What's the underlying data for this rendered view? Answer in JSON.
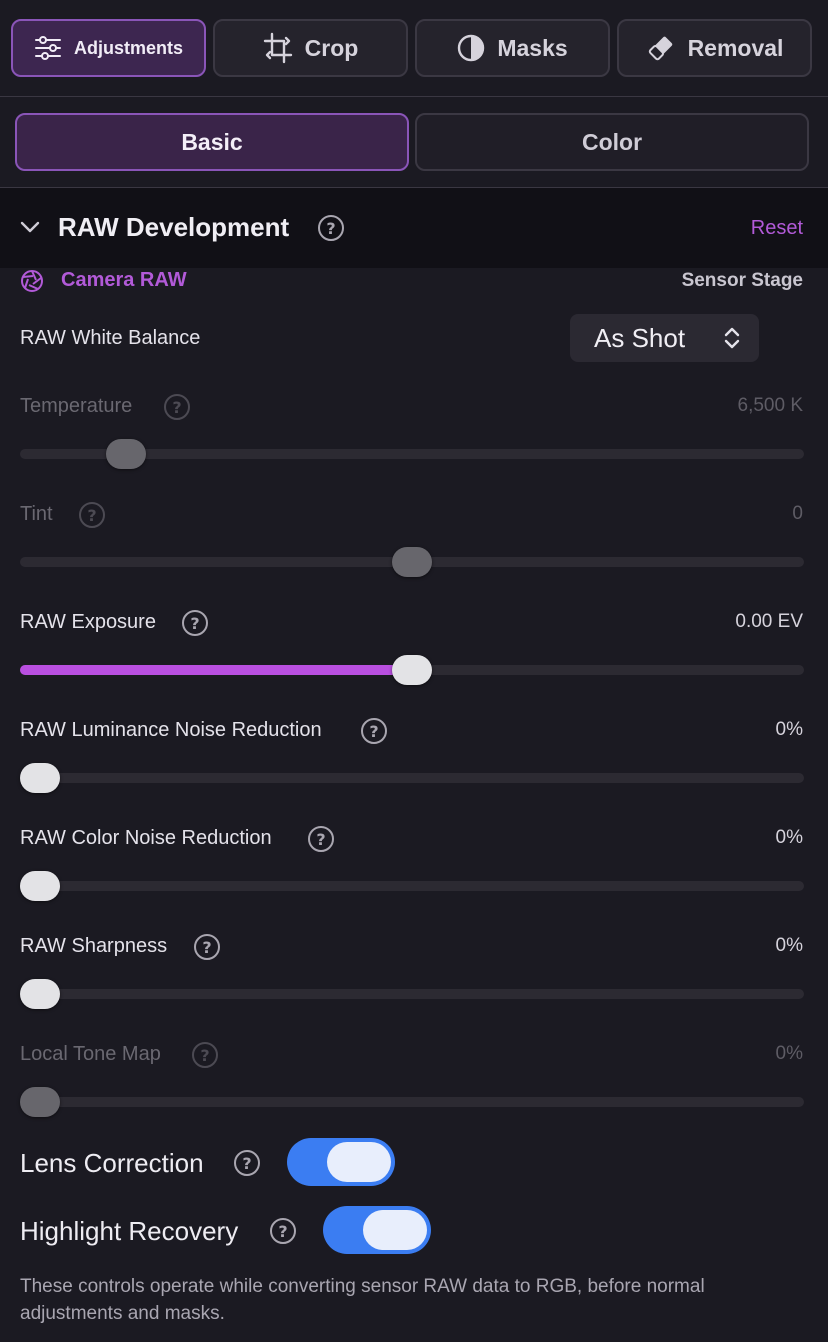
{
  "tool_tabs": [
    {
      "label": "Adjustments",
      "icon": "sliders-icon"
    },
    {
      "label": "Crop",
      "icon": "crop-icon"
    },
    {
      "label": "Masks",
      "icon": "half-circle-icon"
    },
    {
      "label": "Removal",
      "icon": "eraser-icon"
    }
  ],
  "sub_tabs": [
    {
      "label": "Basic"
    },
    {
      "label": "Color"
    }
  ],
  "section": {
    "title": "RAW Development",
    "reset_label": "Reset",
    "stage_label": "Camera RAW",
    "stage_right": "Sensor Stage",
    "help_glyph": "?"
  },
  "white_balance": {
    "label": "RAW White Balance",
    "value": "As Shot"
  },
  "sliders": [
    {
      "label": "Temperature",
      "value": "6,500 K",
      "disabled": true,
      "position": 0.115
    },
    {
      "label": "Tint",
      "value": "0",
      "disabled": true,
      "position": 0.5
    },
    {
      "label": "RAW Exposure",
      "value": "0.00 EV",
      "disabled": false,
      "position": 0.5
    },
    {
      "label": "RAW Luminance Noise Reduction",
      "value": "0%",
      "disabled": false,
      "position": 0
    },
    {
      "label": "RAW Color Noise Reduction",
      "value": "0%",
      "disabled": false,
      "position": 0
    },
    {
      "label": "RAW Sharpness",
      "value": "0%",
      "disabled": false,
      "position": 0
    },
    {
      "label": "Local Tone Map",
      "value": "0%",
      "disabled": true,
      "position": 0
    }
  ],
  "toggles": [
    {
      "label": "Lens Correction",
      "on": true
    },
    {
      "label": "Highlight Recovery",
      "on": true
    }
  ],
  "footnote": "These controls operate while converting sensor RAW data to RGB, before normal adjustments and masks.",
  "colors": {
    "accent": "#b94fe0",
    "toggle_on": "#3b7df2",
    "background": "#1b1a22"
  }
}
